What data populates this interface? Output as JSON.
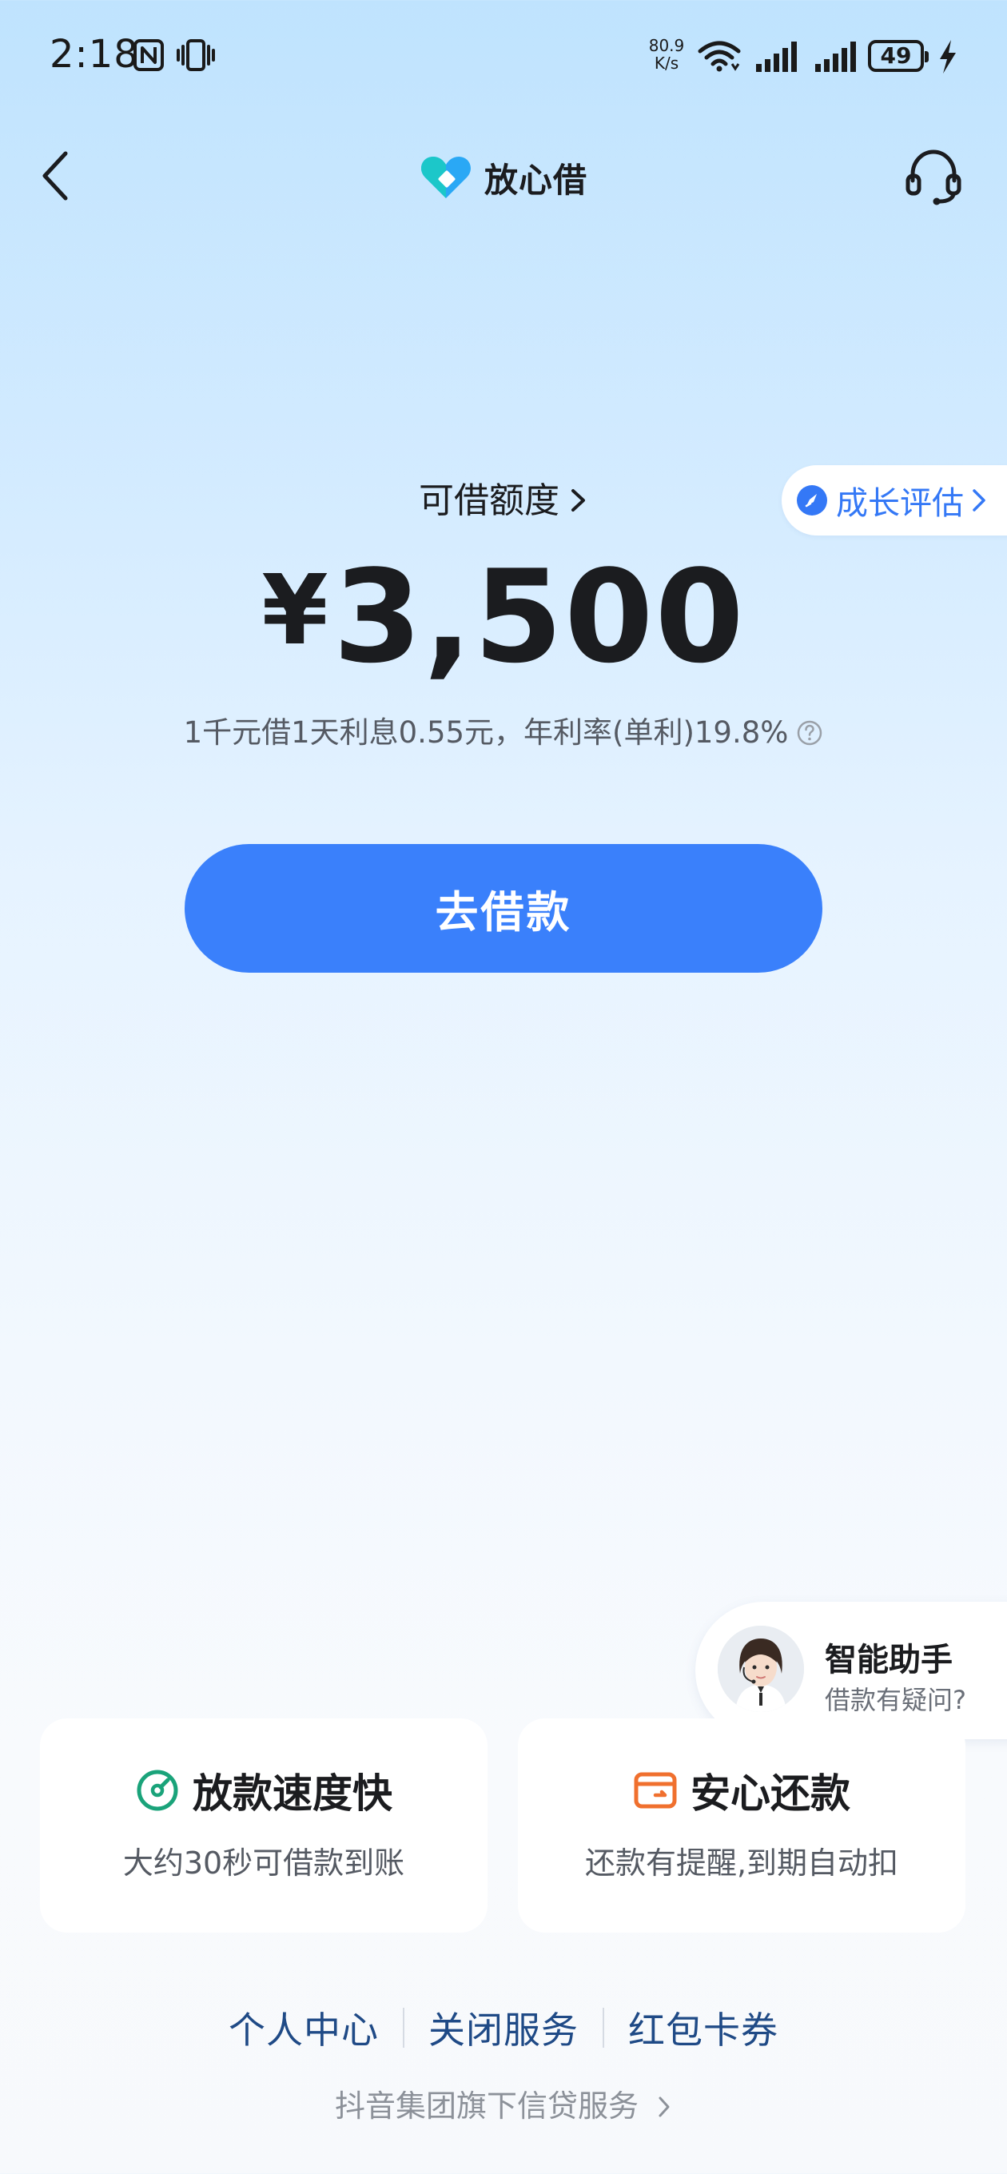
{
  "status_bar": {
    "time": "2:18",
    "network_speed": "80.9",
    "network_speed_unit": "K/s",
    "battery": "49",
    "icons": [
      "nfc-icon",
      "vibrate-icon",
      "wifi-icon",
      "signal-icon",
      "signal-icon",
      "battery-icon",
      "charging-icon"
    ]
  },
  "header": {
    "brand_name": "放心借",
    "back_icon": "chevron-left-icon",
    "support_icon": "headset-icon"
  },
  "credit": {
    "label": "可借额度",
    "currency_symbol": "¥",
    "amount": "3,500",
    "rate_text": "1千元借1天利息0.55元，年利率(单利)19.8%",
    "growth_label": "成长评估"
  },
  "borrow_button": {
    "label": "去借款",
    "color": "#3a80fb"
  },
  "assistant": {
    "title": "智能助手",
    "subtitle": "借款有疑问?"
  },
  "features": [
    {
      "icon": "speedometer-icon",
      "title": "放款速度快",
      "description": "大约30秒可借款到账",
      "color": "#1aa37a"
    },
    {
      "icon": "wallet-icon",
      "title": "安心还款",
      "description": "还款有提醒,到期自动扣",
      "color": "#f0702e"
    }
  ],
  "footer": {
    "links": [
      "个人中心",
      "关闭服务",
      "红包卡券"
    ],
    "note": "抖音集团旗下信贷服务"
  }
}
